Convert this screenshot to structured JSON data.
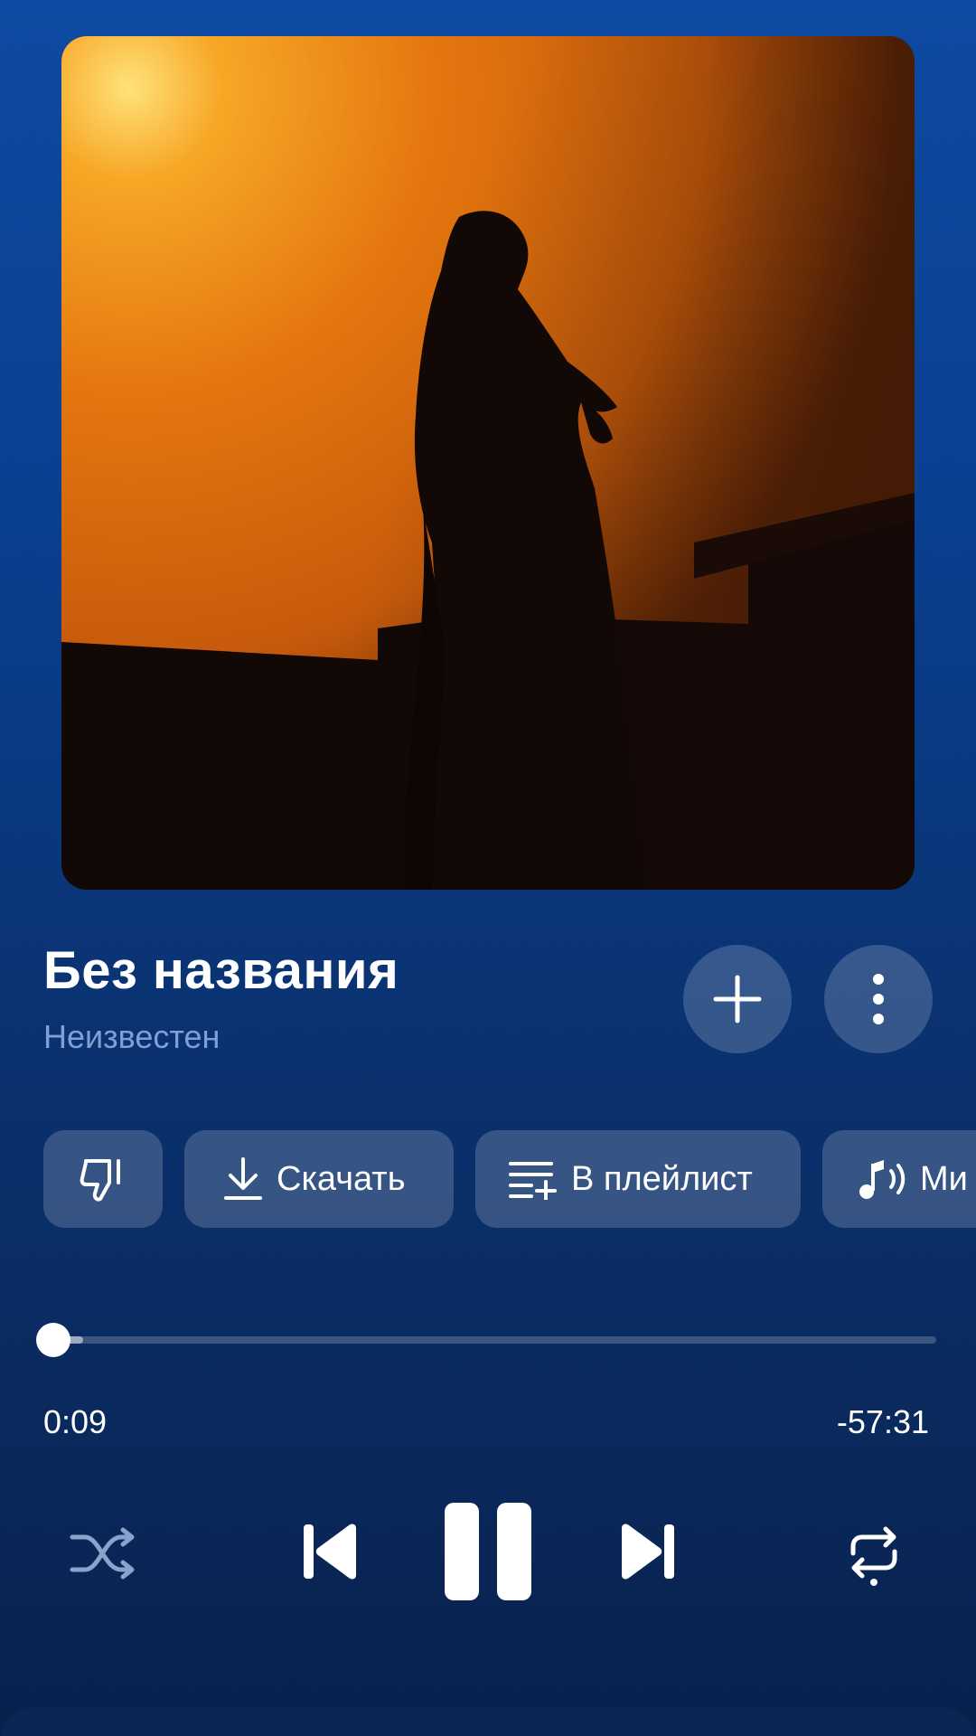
{
  "track": {
    "title": "Без названия",
    "artist": "Неизвестен"
  },
  "actions": {
    "dislike_icon": "thumbs-down-icon",
    "download_label": "Скачать",
    "playlist_label": "В плейлист",
    "mix_label": "Ми"
  },
  "playback": {
    "elapsed": "0:09",
    "remaining": "-57:31",
    "progress_fraction": 0.003,
    "state": "playing"
  },
  "colors": {
    "accent": "#ffffff",
    "secondary_text": "#7fa0d6",
    "background_top": "#0d4aa3",
    "background_bottom": "#08214d"
  }
}
